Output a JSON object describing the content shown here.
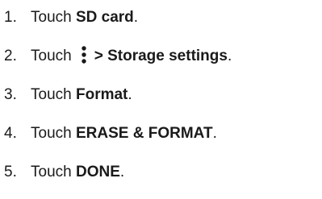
{
  "steps": [
    {
      "number": "1.",
      "verb": "Touch",
      "target": "SD card",
      "end": "."
    },
    {
      "number": "2.",
      "verb": "Touch",
      "icon": "kebab-menu-icon",
      "separator": ">",
      "target": "Storage settings",
      "end": "."
    },
    {
      "number": "3.",
      "verb": "Touch",
      "target": "Format",
      "end": "."
    },
    {
      "number": "4.",
      "verb": "Touch",
      "target": "ERASE & FORMAT",
      "end": "."
    },
    {
      "number": "5.",
      "verb": "Touch",
      "target": "DONE",
      "end": "."
    }
  ]
}
